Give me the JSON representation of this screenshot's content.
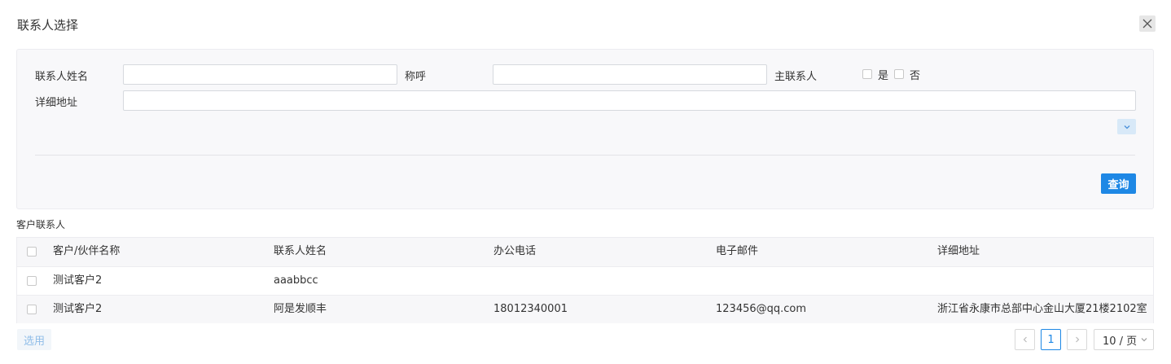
{
  "dialog": {
    "title": "联系人选择"
  },
  "filters": {
    "contact_name_label": "联系人姓名",
    "contact_name_value": "",
    "title_label": "称呼",
    "title_value": "",
    "primary_contact_label": "主联系人",
    "yes_label": "是",
    "no_label": "否",
    "address_label": "详细地址",
    "address_value": "",
    "query_label": "查询"
  },
  "section": {
    "title": "客户联系人"
  },
  "table": {
    "columns": [
      "客户/伙伴名称",
      "联系人姓名",
      "办公电话",
      "电子邮件",
      "详细地址"
    ],
    "rows": [
      [
        "测试客户2",
        "aaabbcc",
        "",
        "",
        ""
      ],
      [
        "测试客户2",
        "阿是发顺丰",
        "18012340001",
        "123456@qq.com",
        "浙江省永康市总部中心金山大厦21楼2102室"
      ]
    ]
  },
  "footer": {
    "select_label": "选用",
    "current_page": "1",
    "page_size": "10 / 页"
  },
  "icons": {
    "close": "close-icon",
    "expand": "chevron-down-icon",
    "prev": "chevron-left-icon",
    "next": "chevron-right-icon",
    "page_size_arrow": "chevron-down-icon"
  },
  "colors": {
    "accent": "#1e88e5",
    "panel_bg": "#f8f8fa"
  }
}
